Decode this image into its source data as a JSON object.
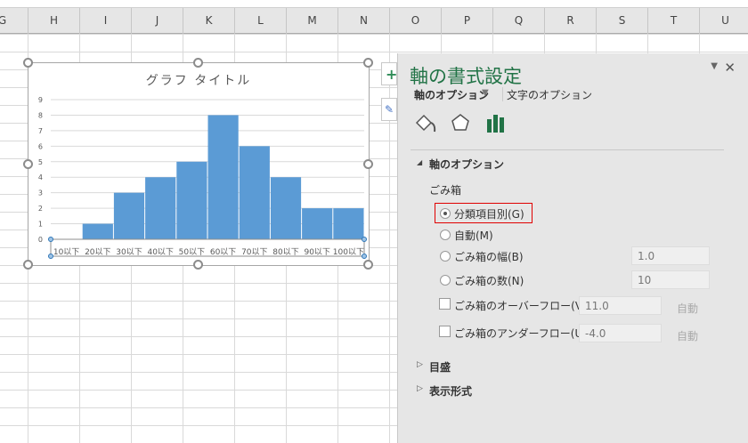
{
  "columns": [
    "G",
    "H",
    "I",
    "J",
    "K",
    "L",
    "M",
    "N",
    "O",
    "P",
    "Q",
    "R",
    "S",
    "T",
    "U"
  ],
  "chart": {
    "title": "グラフ タイトル"
  },
  "chart_data": {
    "type": "bar",
    "title": "グラフ タイトル",
    "categories": [
      "10以下",
      "20以下",
      "30以下",
      "40以下",
      "50以下",
      "60以下",
      "70以下",
      "80以下",
      "90以下",
      "100以下"
    ],
    "values": [
      0,
      1,
      3,
      4,
      5,
      8,
      6,
      4,
      2,
      2
    ],
    "yticks": [
      "0",
      "1",
      "2",
      "3",
      "4",
      "5",
      "6",
      "7",
      "8",
      "9"
    ],
    "ylim": [
      0,
      9
    ],
    "bar_color": "#5b9bd5",
    "grid": true
  },
  "panel": {
    "title": "軸の書式設定",
    "tab_axis": "軸のオプション",
    "tab_text": "文字のオプション",
    "section": "軸のオプション",
    "bins_label": "ごみ箱",
    "opt_category": "分類項目別(G)",
    "opt_auto": "自動(M)",
    "opt_width": "ごみ箱の幅(B)",
    "width_val": "1.0",
    "opt_count": "ごみ箱の数(N)",
    "count_val": "10",
    "overflow": "ごみ箱のオーバーフロー(V)",
    "overflow_val": "11.0",
    "underflow": "ごみ箱のアンダーフロー(U)",
    "underflow_val": "-4.0",
    "auto": "自動",
    "ticks": "目盛",
    "number": "表示形式",
    "accent": "#217346"
  }
}
